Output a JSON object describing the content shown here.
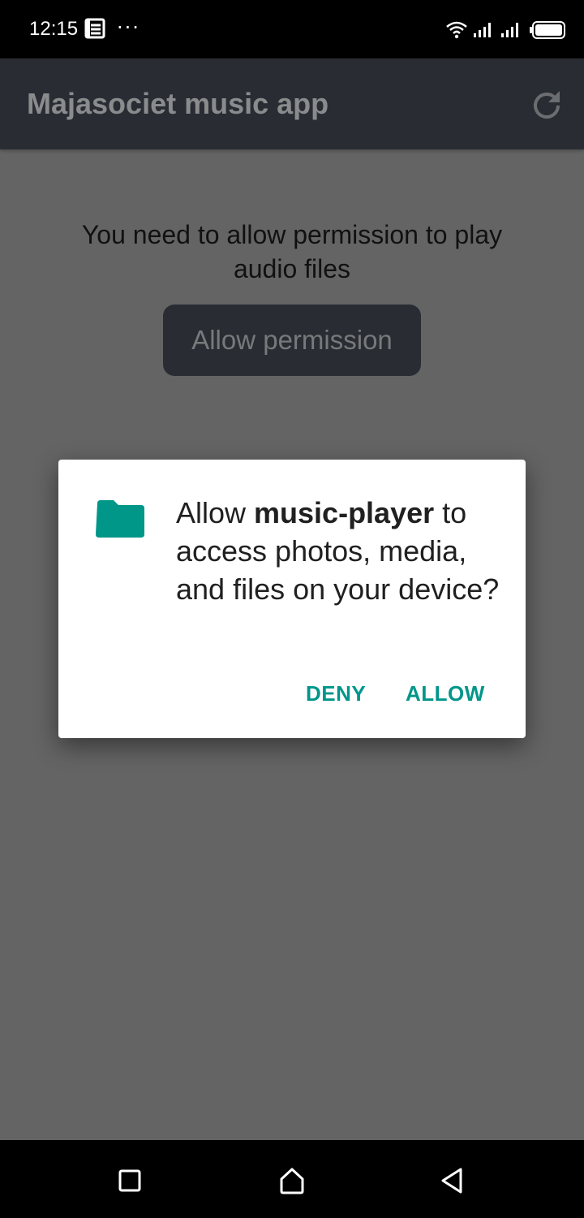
{
  "status_bar": {
    "time": "12:15",
    "more": "···",
    "icons": [
      "notification-icon",
      "wifi-icon",
      "signal-icon",
      "signal-icon",
      "battery-icon"
    ]
  },
  "app_bar": {
    "title": "Majasociet music app",
    "refresh_icon": "refresh-icon"
  },
  "main": {
    "message": "You need to allow permission to play audio files",
    "allow_permission_label": "Allow permission"
  },
  "dialog": {
    "icon": "folder-icon",
    "message_prefix": "Allow ",
    "app_name": "music-player",
    "message_suffix": " to access photos, media, and files on your device?",
    "deny_label": "DENY",
    "allow_label": "ALLOW",
    "accent_color": "#00968a"
  },
  "nav_bar": {
    "icons": [
      "recents-icon",
      "home-icon",
      "back-icon"
    ]
  },
  "colors": {
    "app_bar": "#292d33",
    "scrim": "#646464",
    "folder": "#009688"
  }
}
